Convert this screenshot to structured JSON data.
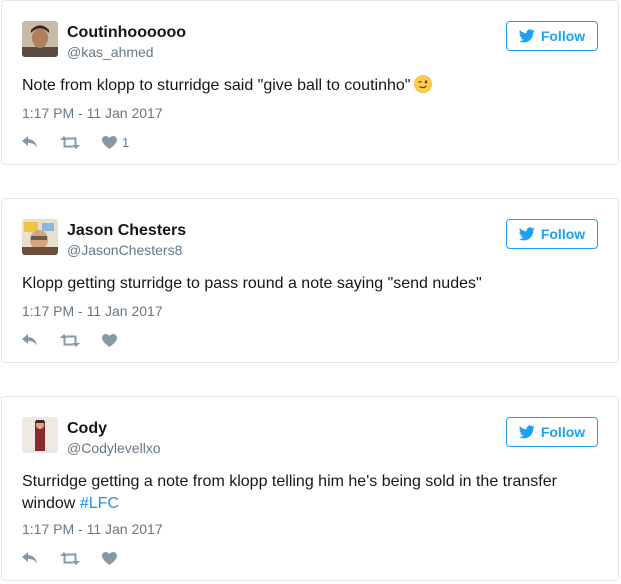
{
  "tweets": [
    {
      "name": "Coutinhoooooo",
      "handle": "@kas_ahmed",
      "text": "Note from klopp to sturridge said \"give ball to coutinho\"",
      "emoji": "winking-face",
      "timestamp": "1:17 PM - 11 Jan 2017",
      "like_count": "1",
      "follow_label": "Follow"
    },
    {
      "name": "Jason Chesters",
      "handle": "@JasonChesters8",
      "text": "Klopp getting sturridge to pass round a note saying \"send nudes\"",
      "timestamp": "1:17 PM - 11 Jan 2017",
      "like_count": "",
      "follow_label": "Follow"
    },
    {
      "name": "Cody",
      "handle": "@Codylevellxo",
      "text_line1": "Sturridge getting a note from klopp telling him he's being sold in the transfer",
      "text_line2": "window ",
      "hashtag": "#LFC",
      "timestamp": "1:17 PM - 11 Jan 2017",
      "like_count": "",
      "follow_label": "Follow"
    }
  ],
  "colors": {
    "accent": "#1da1f2",
    "hashtag": "#1b95e0",
    "muted": "#657786",
    "icon": "#8899a6",
    "border": "#e1e8ed"
  },
  "icons": [
    "reply-icon",
    "retweet-icon",
    "heart-icon",
    "twitter-bird-icon"
  ]
}
